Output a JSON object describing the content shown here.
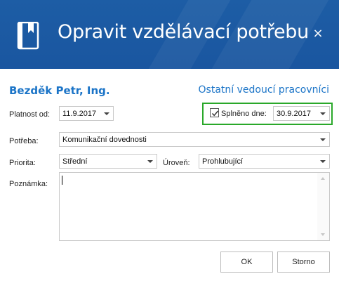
{
  "dialog": {
    "title": "Opravit vzdělávací potřebu",
    "close_glyph": "×",
    "icon": "book-icon",
    "header_color": "#1a56a0"
  },
  "person": {
    "name": "Bezděk Petr, Ing.",
    "role": "Ostatní vedoucí pracovníci"
  },
  "form": {
    "validity_label": "Platnost od:",
    "validity_value": "11.9.2017",
    "completed_label": "Splněno dne:",
    "completed_checked": true,
    "completed_value": "30.9.2017",
    "need_label": "Potřeba:",
    "need_value": "Komunikační dovednosti",
    "priority_label": "Priorita:",
    "priority_value": "Střední",
    "level_label": "Úroveň:",
    "level_value": "Prohlubující",
    "note_label": "Poznámka:",
    "note_value": ""
  },
  "buttons": {
    "ok": "OK",
    "cancel": "Storno"
  },
  "colors": {
    "accent_text": "#1b74c7",
    "highlight_border": "#2aa82a"
  }
}
